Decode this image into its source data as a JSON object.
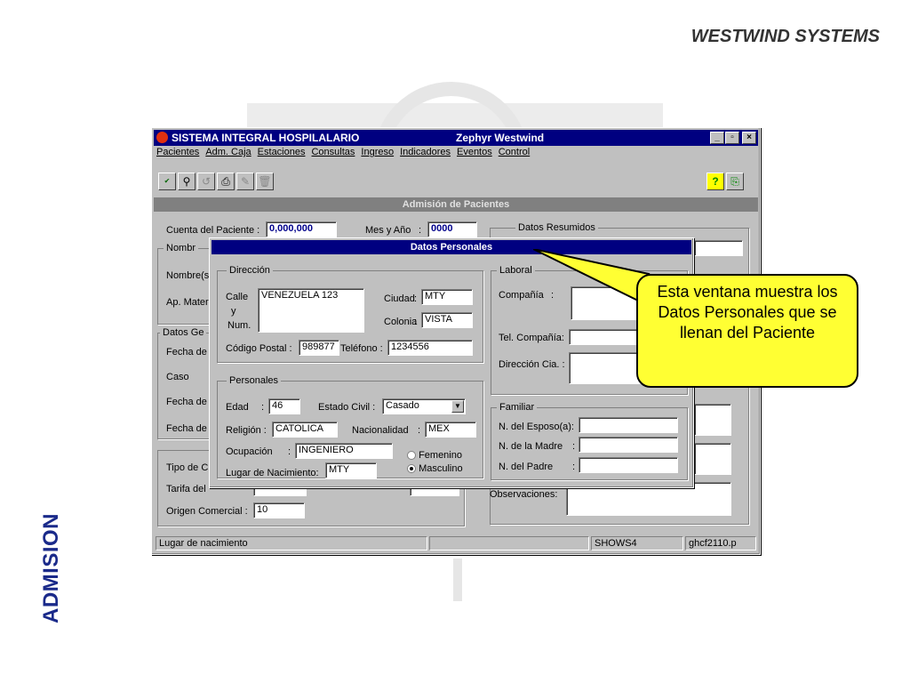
{
  "brand": "WESTWIND  SYSTEMS",
  "side_label": "ADMISION",
  "window": {
    "title": "SISTEMA INTEGRAL HOSPILALARIO",
    "subtitle": "Zephyr Westwind",
    "menu": [
      "Pacientes",
      "Adm. Caja",
      "Estaciones",
      "Consultas",
      "Ingreso",
      "Indicadores",
      "Eventos",
      "Control"
    ],
    "band": "Admisión de Pacientes"
  },
  "main": {
    "cuenta_label": "Cuenta del Paciente :",
    "cuenta_value": "0,000,000",
    "mes_label": "Mes y Año",
    "mes_value": "0000",
    "resumidos": "Datos Resumidos",
    "nombre_group": "Nombr",
    "nombres": "Nombre(s)",
    "ap_mater": "Ap. Mater",
    "datos_ge": "Datos Ge",
    "fecha_de1": "Fecha  de",
    "caso": "Caso",
    "fecha_de2": "Fecha de",
    "fecha_de3": "Fecha de",
    "tipo": "Tipo de C",
    "tarifa": "Tarifa del",
    "origen_label": "Origen Comercial :",
    "origen_value": "10",
    "observaciones": "Observaciones:"
  },
  "dialog": {
    "title": "Datos Personales",
    "direccion": "Dirección",
    "calle_label": "Calle",
    "y_label": "y",
    "num_label": "Num.",
    "calle_value": "VENEZUELA 123",
    "ciudad_label": "Ciudad",
    "ciudad_value": "MTY",
    "colonia_label": "Colonia",
    "colonia_value": "VISTA",
    "cp_label": "Código Postal :",
    "cp_value": "989877",
    "tel_label": "Teléfono :",
    "tel_value": "1234556",
    "personales": "Personales",
    "edad_label": "Edad",
    "edad_value": "46",
    "civil_label": "Estado  Civil :",
    "civil_value": "Casado",
    "religion_label": "Religión :",
    "religion_value": "CATOLICA",
    "nac_label": "Nacionalidad",
    "nac_value": "MEX",
    "ocup_label": "Ocupación",
    "ocup_value": "INGENIERO",
    "fem": "Femenino",
    "masc": "Masculino",
    "lugar_label": "Lugar de Nacimiento:",
    "lugar_value": "MTY",
    "laboral": "Laboral",
    "compania": "Compañía",
    "tel_comp": "Tel. Compañía:",
    "dir_cia": "Dirección Cia. :",
    "familiar": "Familiar",
    "esposo": "N. del Esposo(a):",
    "madre": "N. de la Madre",
    "padre": "N. del Padre"
  },
  "status": {
    "left": "Lugar de nacimiento",
    "mid": "SHOWS4",
    "right": "ghcf2110.p"
  },
  "callout": "Esta ventana muestra los Datos Personales que se llenan del Paciente",
  "colors": {
    "title_bar": "#000080",
    "callout": "#ffff33",
    "side": "#1a2a8a"
  }
}
